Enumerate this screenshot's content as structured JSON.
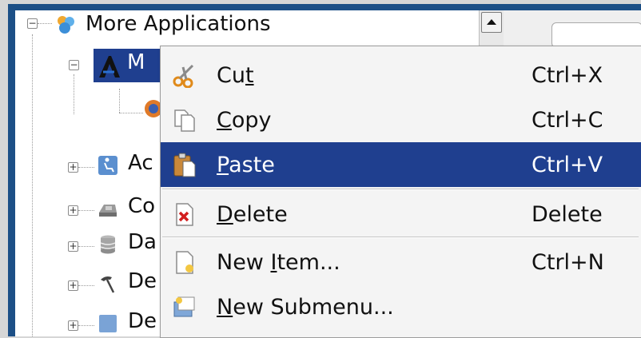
{
  "tree": {
    "root_label": "More Applications",
    "child_label": "M",
    "rows": [
      {
        "label": "Ac",
        "icon": "accessibility-icon"
      },
      {
        "label": "Co",
        "icon": "hardware-icon"
      },
      {
        "label": "Da",
        "icon": "database-icon"
      },
      {
        "label": "De",
        "icon": "hammer-icon"
      },
      {
        "label": "De",
        "icon": "desktop-icon"
      }
    ]
  },
  "menu": {
    "items": [
      {
        "label": "Cut",
        "mnemonic_index": 2,
        "shortcut": "Ctrl+X",
        "icon": "scissors-icon"
      },
      {
        "label": "Copy",
        "mnemonic_index": 0,
        "shortcut": "Ctrl+C",
        "icon": "copy-icon"
      },
      {
        "label": "Paste",
        "mnemonic_index": 0,
        "shortcut": "Ctrl+V",
        "icon": "paste-icon",
        "highlighted": true
      },
      {
        "label": "Delete",
        "mnemonic_index": 0,
        "shortcut": "Delete",
        "icon": "delete-icon"
      },
      {
        "label": "New Item...",
        "mnemonic_index": 4,
        "shortcut": "Ctrl+N",
        "icon": "new-item-icon"
      },
      {
        "label": "New Submenu...",
        "mnemonic_index": 0,
        "shortcut": "",
        "icon": "new-submenu-icon"
      }
    ]
  },
  "colors": {
    "frame": "#1c4f86",
    "selection": "#1f3f8f",
    "menu_bg": "#f4f4f4"
  }
}
